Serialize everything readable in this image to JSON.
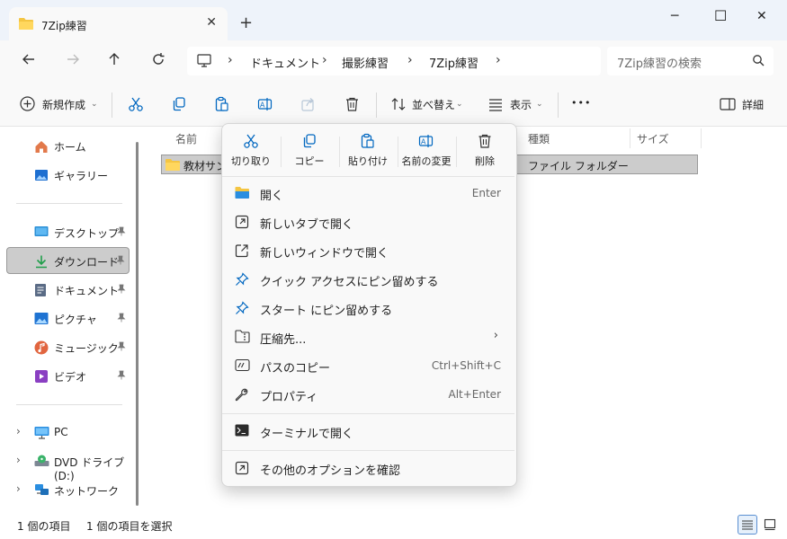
{
  "tab": {
    "title": "7Zip練習",
    "close": "✕"
  },
  "window_controls": {
    "minimize": "─",
    "maximize": "☐",
    "close": "✕"
  },
  "new_tab": "+",
  "address": {
    "crumbs": [
      "ドキュメント",
      "撮影練習",
      "7Zip練習"
    ]
  },
  "search": {
    "placeholder": "7Zip練習の検索"
  },
  "toolbar": {
    "new": "新規作成",
    "sort": "並べ替え",
    "view": "表示",
    "details": "詳細",
    "more": "•••"
  },
  "sidebar": {
    "items": [
      {
        "label": "ホーム",
        "icon": "home-icon"
      },
      {
        "label": "ギャラリー",
        "icon": "gallery-icon"
      },
      {
        "label": "デスクトップ",
        "icon": "desktop-icon"
      },
      {
        "label": "ダウンロード",
        "icon": "download-icon"
      },
      {
        "label": "ドキュメント",
        "icon": "documents-icon"
      },
      {
        "label": "ピクチャ",
        "icon": "pictures-icon"
      },
      {
        "label": "ミュージック",
        "icon": "music-icon"
      },
      {
        "label": "ビデオ",
        "icon": "video-icon"
      },
      {
        "label": "PC",
        "icon": "pc-icon"
      },
      {
        "label": "DVD ドライブ (D:)",
        "icon": "dvd-drive-icon"
      },
      {
        "label": "ネットワーク",
        "icon": "network-icon"
      }
    ]
  },
  "columns": {
    "name": "名前",
    "type": "種類",
    "size": "サイズ"
  },
  "rows": [
    {
      "name": "教材サン",
      "type": "ファイル フォルダー"
    }
  ],
  "status": {
    "count": "1 個の項目",
    "selected": "1 個の項目を選択"
  },
  "context_menu": {
    "quick_actions": [
      "切り取り",
      "コピー",
      "貼り付け",
      "名前の変更",
      "削除"
    ],
    "items": [
      {
        "label": "開く",
        "shortcut": "Enter"
      },
      {
        "label": "新しいタブで開く",
        "shortcut": ""
      },
      {
        "label": "新しいウィンドウで開く",
        "shortcut": ""
      },
      {
        "label": "クイック アクセスにピン留めする",
        "shortcut": ""
      },
      {
        "label": "スタート にピン留めする",
        "shortcut": ""
      },
      {
        "label": "圧縮先...",
        "shortcut": ""
      },
      {
        "label": "パスのコピー",
        "shortcut": "Ctrl+Shift+C"
      },
      {
        "label": "プロパティ",
        "shortcut": "Alt+Enter"
      },
      {
        "label": "ターミナルで開く",
        "shortcut": ""
      },
      {
        "label": "その他のオプションを確認",
        "shortcut": ""
      }
    ]
  },
  "colors": {
    "accent": "#0067c0",
    "folder": "#f4c542",
    "selection": "#cccccc"
  }
}
